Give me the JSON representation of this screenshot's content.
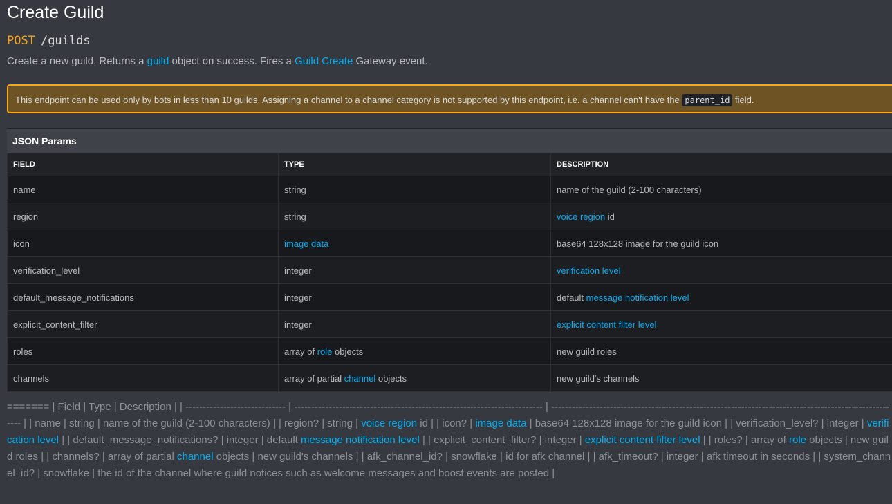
{
  "title": "Create Guild",
  "endpoint": {
    "method": "POST",
    "path": "/guilds"
  },
  "description": {
    "part1": "Create a new guild. Returns a ",
    "link1": "guild",
    "part2": " object on success. Fires a ",
    "link2": "Guild Create",
    "part3": " Gateway event."
  },
  "warning": {
    "text": "This endpoint can be used only by bots in less than 10 guilds. Assigning a channel to a channel category is not supported by this endpoint, i.e. a channel can't have the ",
    "code": "parent_id",
    "suffix": " field."
  },
  "params": {
    "title": "JSON Params",
    "headers": [
      "FIELD",
      "TYPE",
      "DESCRIPTION"
    ],
    "rows": [
      {
        "field": "name",
        "type_pre": "string",
        "type_link": "",
        "type_post": "",
        "desc_pre": "name of the guild (2-100 characters)",
        "desc_link": "",
        "desc_post": ""
      },
      {
        "field": "region",
        "type_pre": "string",
        "type_link": "",
        "type_post": "",
        "desc_pre": "",
        "desc_link": "voice region",
        "desc_post": " id"
      },
      {
        "field": "icon",
        "type_pre": "",
        "type_link": "image data",
        "type_post": "",
        "desc_pre": "base64 128x128 image for the guild icon",
        "desc_link": "",
        "desc_post": ""
      },
      {
        "field": "verification_level",
        "type_pre": "integer",
        "type_link": "",
        "type_post": "",
        "desc_pre": "",
        "desc_link": "verification level",
        "desc_post": ""
      },
      {
        "field": "default_message_notifications",
        "type_pre": "integer",
        "type_link": "",
        "type_post": "",
        "desc_pre": "default ",
        "desc_link": "message notification level",
        "desc_post": ""
      },
      {
        "field": "explicit_content_filter",
        "type_pre": "integer",
        "type_link": "",
        "type_post": "",
        "desc_pre": "",
        "desc_link": "explicit content filter level",
        "desc_post": ""
      },
      {
        "field": "roles",
        "type_pre": "array of ",
        "type_link": "role",
        "type_post": " objects",
        "desc_pre": "new guild roles",
        "desc_link": "",
        "desc_post": ""
      },
      {
        "field": "channels",
        "type_pre": "array of partial ",
        "type_link": "channel",
        "type_post": " objects",
        "desc_pre": "new guild's channels",
        "desc_link": "",
        "desc_post": ""
      }
    ]
  },
  "raw_markdown": [
    {
      "t": "======= | Field | Type | Description | | ----------------------------- | ------------------------------------------------------------------------ | ------------------------------------------------------------------------------------------------------ | | name | string | name of the guild (2-100 characters) | | region? | string | "
    },
    {
      "l": "voice region"
    },
    {
      "t": " id | | icon? | "
    },
    {
      "l": "image data"
    },
    {
      "t": " | base64 128x128 image for the guild icon | | verification_level? | integer | "
    },
    {
      "l": "verification level"
    },
    {
      "t": " | | default_message_notifications? | integer | default "
    },
    {
      "l": "message notification level"
    },
    {
      "t": " | | explicit_content_filter? | integer | "
    },
    {
      "l": "explicit content filter level"
    },
    {
      "t": " | | roles? | array of "
    },
    {
      "l": "role"
    },
    {
      "t": " objects | new guild roles | | channels? | array of partial "
    },
    {
      "l": "channel"
    },
    {
      "t": " objects | new guild's channels | | afk_channel_id? | snowflake | id for afk channel | | afk_timeout? | integer | afk timeout in seconds | | system_channel_id? | snowflake | the id of the channel where guild notices such as welcome messages and boost events are posted |"
    }
  ]
}
